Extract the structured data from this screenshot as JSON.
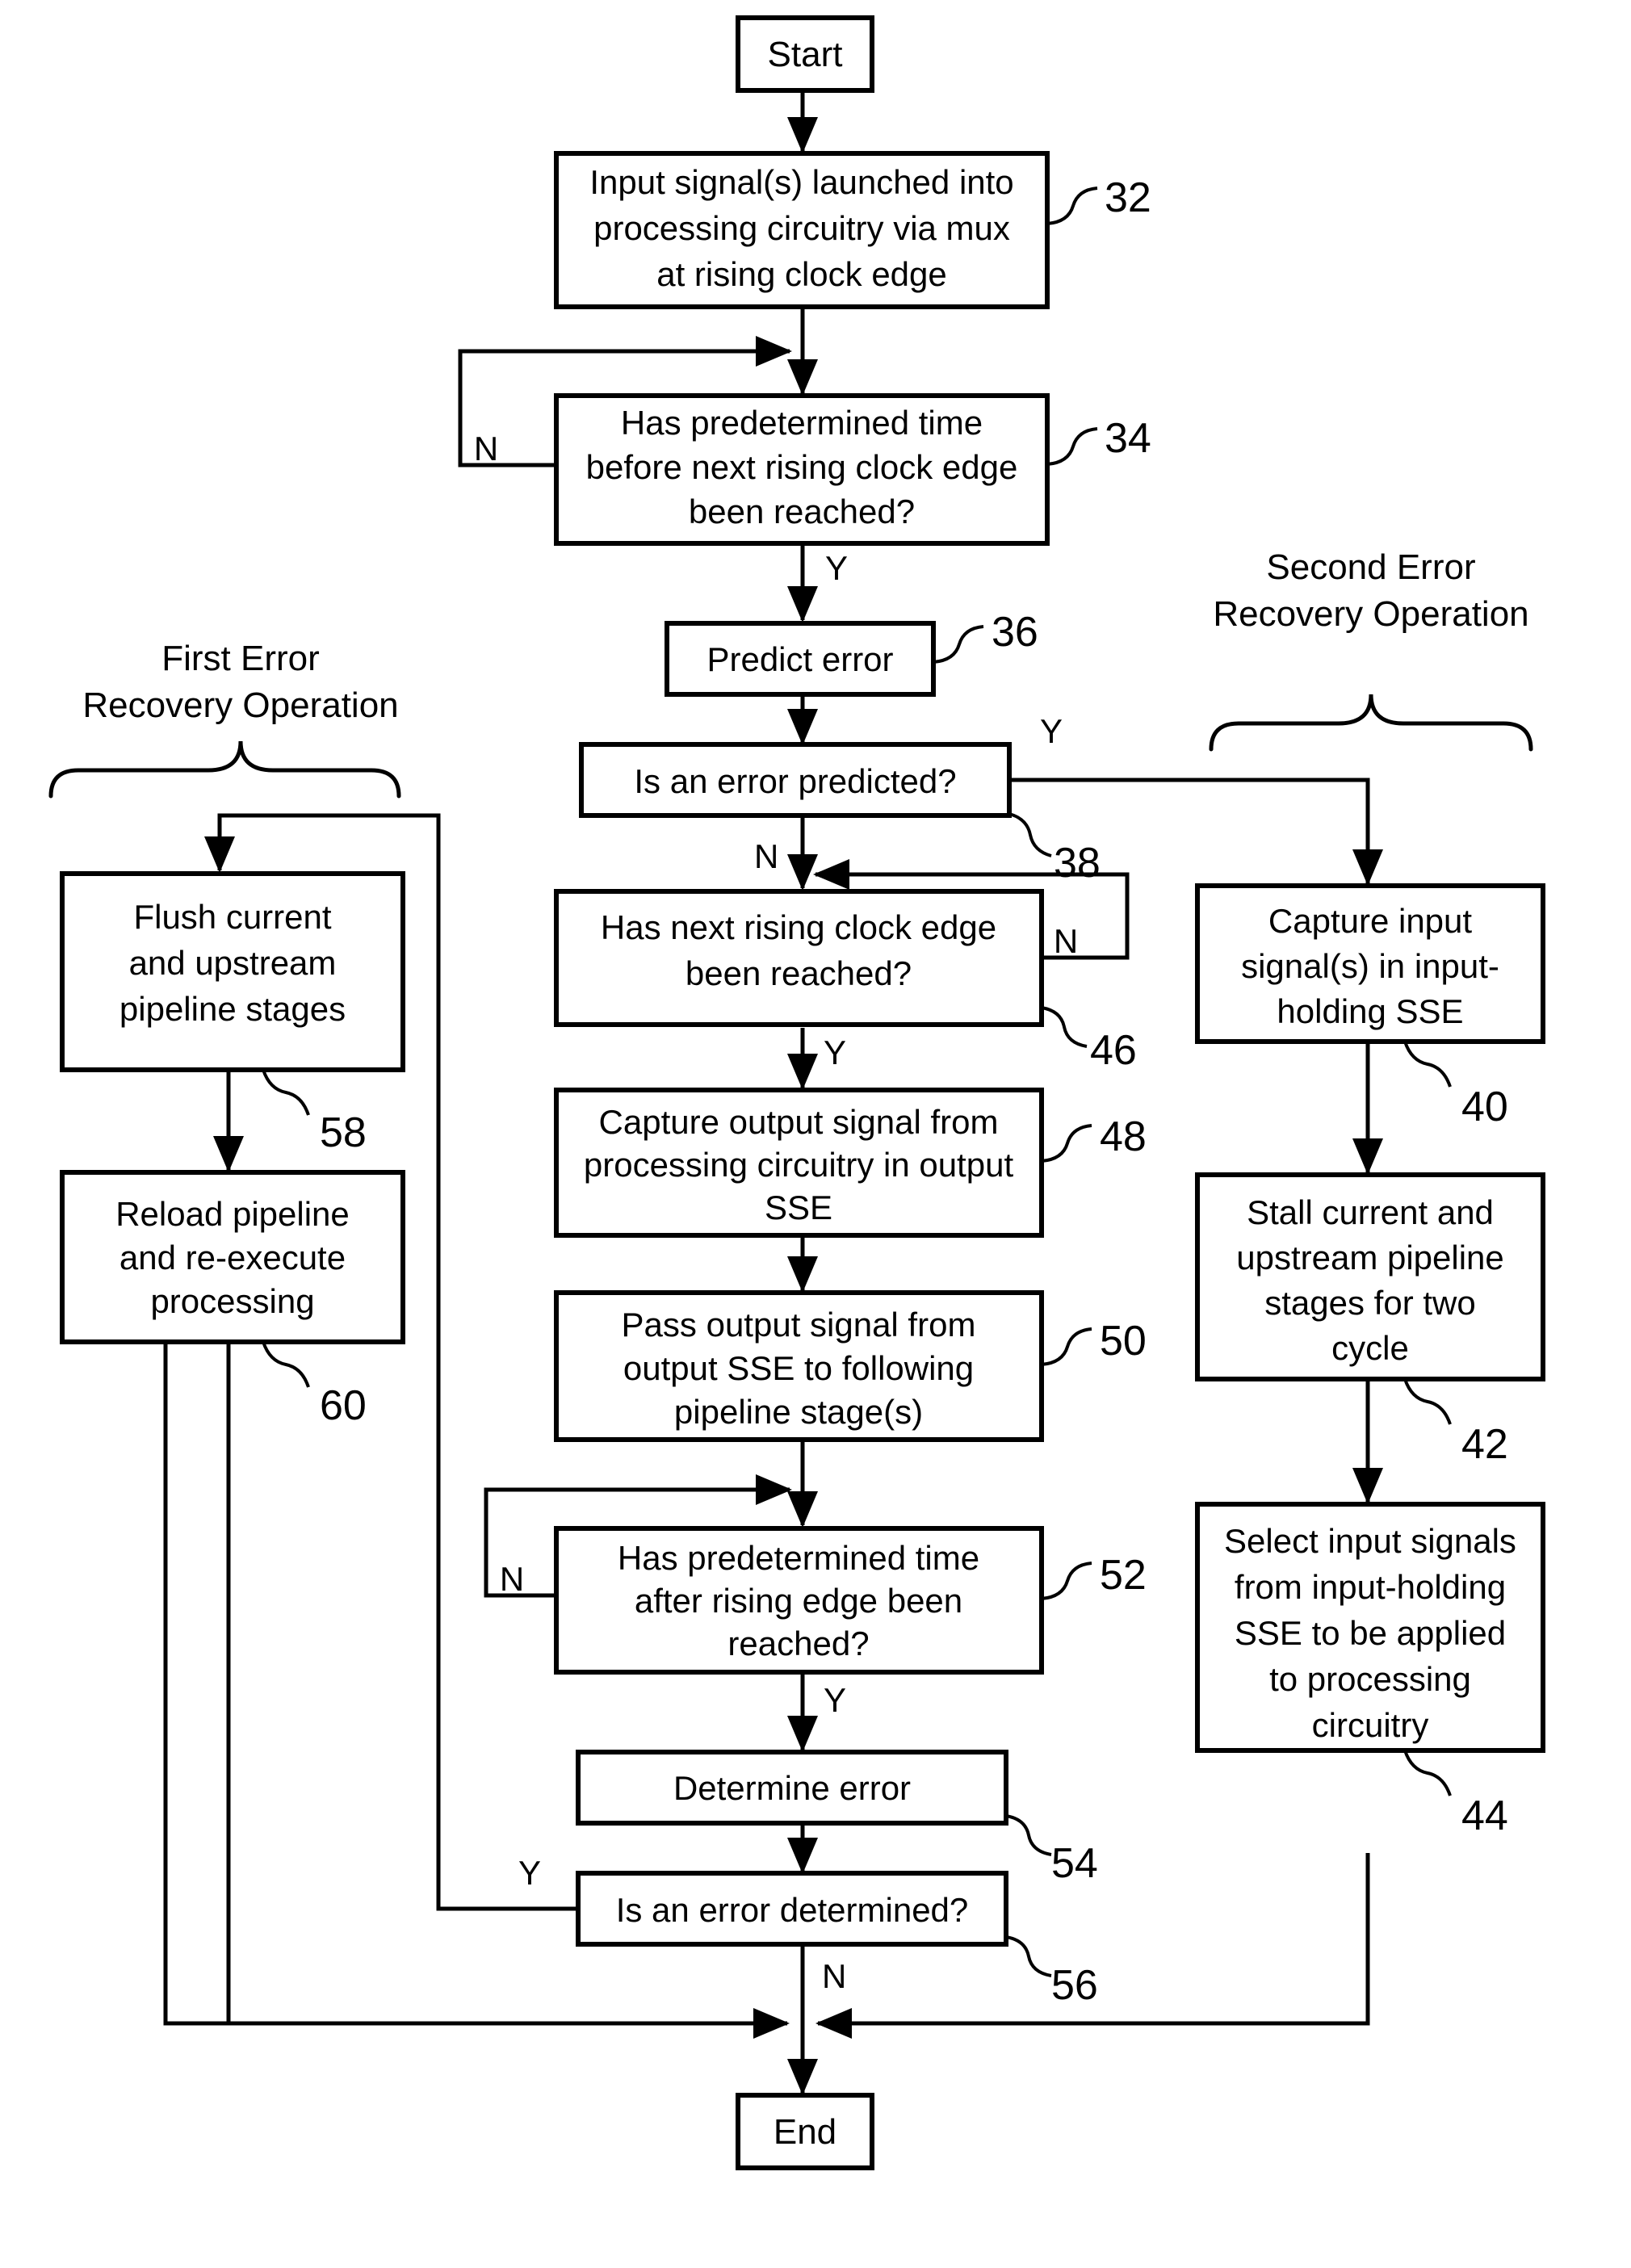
{
  "figure": {
    "type": "flowchart",
    "title_terminals": {
      "start": "Start",
      "end": "End"
    },
    "group_labels": {
      "left": {
        "line1": "First Error",
        "line2": "Recovery Operation"
      },
      "right": {
        "line1": "Second Error",
        "line2": "Recovery Operation"
      }
    },
    "nodes": [
      {
        "id": "start",
        "ref": "",
        "shape": "terminator",
        "lines": [
          "Start"
        ]
      },
      {
        "id": "n32",
        "ref": "32",
        "shape": "process",
        "lines": [
          "Input signal(s) launched into",
          "processing circuitry via mux",
          "at rising clock edge"
        ]
      },
      {
        "id": "n34",
        "ref": "34",
        "shape": "decision",
        "lines": [
          "Has predetermined time",
          "before next rising clock edge",
          "been reached?"
        ]
      },
      {
        "id": "n36",
        "ref": "36",
        "shape": "process",
        "lines": [
          "Predict error"
        ]
      },
      {
        "id": "n38",
        "ref": "38",
        "shape": "decision",
        "lines": [
          "Is an error predicted?"
        ]
      },
      {
        "id": "n46",
        "ref": "46",
        "shape": "decision",
        "lines": [
          "Has next rising clock edge",
          "been reached?"
        ]
      },
      {
        "id": "n48",
        "ref": "48",
        "shape": "process",
        "lines": [
          "Capture output signal from",
          "processing circuitry in output",
          "SSE"
        ]
      },
      {
        "id": "n50",
        "ref": "50",
        "shape": "process",
        "lines": [
          "Pass output signal from",
          "output SSE to following",
          "pipeline stage(s)"
        ]
      },
      {
        "id": "n52",
        "ref": "52",
        "shape": "decision",
        "lines": [
          "Has predetermined time",
          "after rising edge been",
          "reached?"
        ]
      },
      {
        "id": "n54",
        "ref": "54",
        "shape": "process",
        "lines": [
          "Determine error"
        ]
      },
      {
        "id": "n56",
        "ref": "56",
        "shape": "decision",
        "lines": [
          "Is an error determined?"
        ]
      },
      {
        "id": "n58",
        "ref": "58",
        "shape": "process",
        "lines": [
          "Flush current",
          "and upstream",
          "pipeline stages"
        ]
      },
      {
        "id": "n60",
        "ref": "60",
        "shape": "process",
        "lines": [
          "Reload pipeline",
          "and re-execute",
          "processing"
        ]
      },
      {
        "id": "n40",
        "ref": "40",
        "shape": "process",
        "lines": [
          "Capture input",
          "signal(s) in input-",
          "holding SSE"
        ]
      },
      {
        "id": "n42",
        "ref": "42",
        "shape": "process",
        "lines": [
          "Stall current and",
          "upstream pipeline",
          "stages for two",
          "cycle"
        ]
      },
      {
        "id": "n44",
        "ref": "44",
        "shape": "process",
        "lines": [
          "Select input signals",
          "from input-holding",
          "SSE to be applied",
          "to processing",
          "circuitry"
        ]
      },
      {
        "id": "end",
        "ref": "",
        "shape": "terminator",
        "lines": [
          "End"
        ]
      }
    ],
    "edge_labels": {
      "n34_no": "N",
      "n34_yes": "Y",
      "n38_yes": "Y",
      "n38_no": "N",
      "n46_no": "N",
      "n46_yes": "Y",
      "n52_no": "N",
      "n52_yes": "Y",
      "n56_yes": "Y",
      "n56_no": "N"
    },
    "reference_numerals": [
      "32",
      "34",
      "36",
      "38",
      "40",
      "42",
      "44",
      "46",
      "48",
      "50",
      "52",
      "54",
      "56",
      "58",
      "60"
    ],
    "colors": {
      "stroke": "#000000",
      "fill": "#ffffff",
      "background": "#ffffff"
    }
  }
}
